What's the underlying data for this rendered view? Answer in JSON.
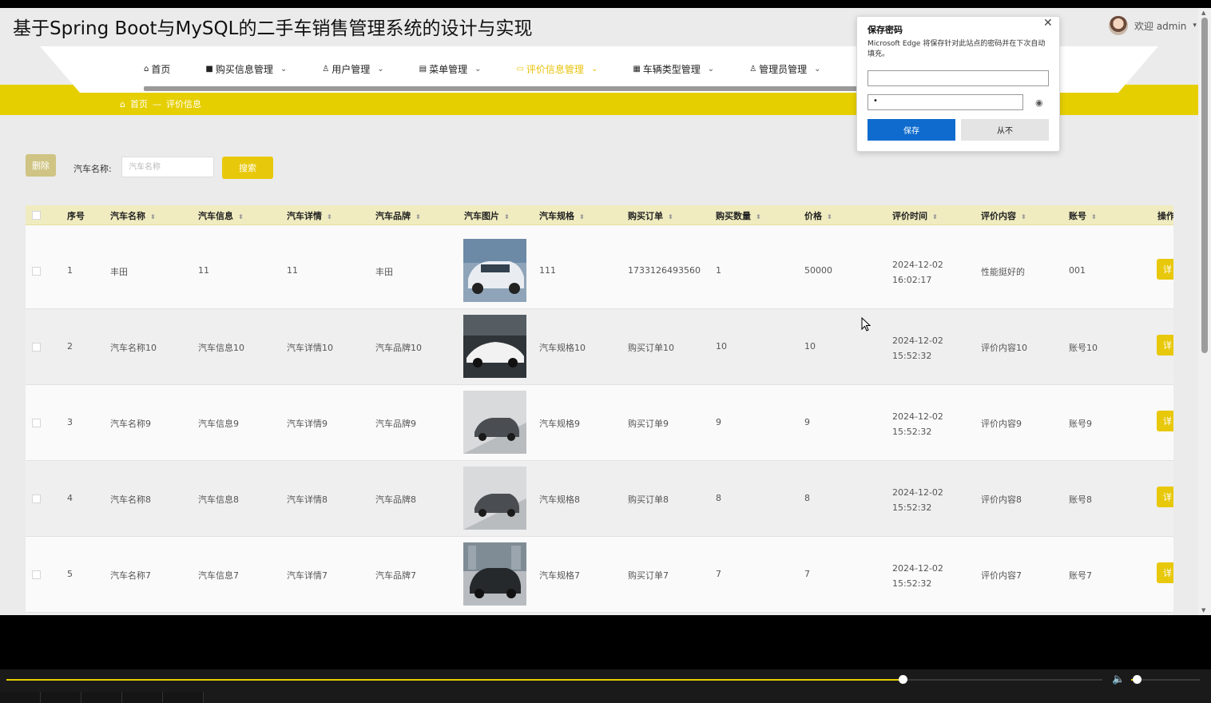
{
  "app_title": "基于Spring Boot与MySQL的二手车销售管理系统的设计与实现",
  "user": {
    "welcome": "欢迎 admin"
  },
  "nav": [
    {
      "label": "首页",
      "icon": "home-icon",
      "has_dropdown": false,
      "active": false
    },
    {
      "label": "购买信息管理",
      "icon": "bag-icon",
      "has_dropdown": true,
      "active": false
    },
    {
      "label": "用户管理",
      "icon": "user-icon",
      "has_dropdown": true,
      "active": false
    },
    {
      "label": "菜单管理",
      "icon": "menu-icon",
      "has_dropdown": true,
      "active": false
    },
    {
      "label": "评价信息管理",
      "icon": "comment-icon",
      "has_dropdown": true,
      "active": true
    },
    {
      "label": "车辆类型管理",
      "icon": "grid-icon",
      "has_dropdown": true,
      "active": false
    },
    {
      "label": "管理员管理",
      "icon": "admin-icon",
      "has_dropdown": true,
      "active": false
    }
  ],
  "breadcrumb": {
    "home": "首页",
    "separator": "—",
    "current": "评价信息"
  },
  "toolbar": {
    "delete_label": "删除",
    "search_label": "汽车名称:",
    "search_placeholder": "汽车名称",
    "search_value": "",
    "search_button": "搜索"
  },
  "table": {
    "headers": [
      "序号",
      "汽车名称",
      "汽车信息",
      "汽车详情",
      "汽车品牌",
      "汽车图片",
      "汽车规格",
      "购买订单",
      "购买数量",
      "价格",
      "评价时间",
      "评价内容",
      "账号",
      "操作"
    ],
    "rows": [
      {
        "no": "1",
        "name": "丰田",
        "info": "11",
        "detail": "11",
        "brand": "丰田",
        "image": "white-suv-photo",
        "spec": "111",
        "order": "1733126493560",
        "qty": "1",
        "price": "50000",
        "time": "2024-12-02 16:02:17",
        "content": "性能挺好的",
        "account": "001",
        "action": "详"
      },
      {
        "no": "2",
        "name": "汽车名称10",
        "info": "汽车信息10",
        "detail": "汽车详情10",
        "brand": "汽车品牌10",
        "image": "white-sportscar-photo",
        "spec": "汽车规格10",
        "order": "购买订单10",
        "qty": "10",
        "price": "10",
        "time": "2024-12-02 15:52:32",
        "content": "评价内容10",
        "account": "账号10",
        "action": "详"
      },
      {
        "no": "3",
        "name": "汽车名称9",
        "info": "汽车信息9",
        "detail": "汽车详情9",
        "brand": "汽车品牌9",
        "image": "grey-suv-photo",
        "spec": "汽车规格9",
        "order": "购买订单9",
        "qty": "9",
        "price": "9",
        "time": "2024-12-02 15:52:32",
        "content": "评价内容9",
        "account": "账号9",
        "action": "详"
      },
      {
        "no": "4",
        "name": "汽车名称8",
        "info": "汽车信息8",
        "detail": "汽车详情8",
        "brand": "汽车品牌8",
        "image": "grey-suv-photo",
        "spec": "汽车规格8",
        "order": "购买订单8",
        "qty": "8",
        "price": "8",
        "time": "2024-12-02 15:52:32",
        "content": "评价内容8",
        "account": "账号8",
        "action": "详"
      },
      {
        "no": "5",
        "name": "汽车名称7",
        "info": "汽车信息7",
        "detail": "汽车详情7",
        "brand": "汽车品牌7",
        "image": "dark-suv-photo",
        "spec": "汽车规格7",
        "order": "购买订单7",
        "qty": "7",
        "price": "7",
        "time": "2024-12-02 15:52:32",
        "content": "评价内容7",
        "account": "账号7",
        "action": "详"
      }
    ]
  },
  "password_popup": {
    "title": "保存密码",
    "description": "Microsoft Edge 将保存针对此站点的密码并在下次自动填充。",
    "username_value": "",
    "password_value": "•",
    "save_label": "保存",
    "never_label": "从不"
  },
  "player": {
    "progress": 0.818,
    "volume": 0.08
  },
  "colors": {
    "accent_yellow": "#e6cf00",
    "edge_blue": "#0f6cce"
  }
}
